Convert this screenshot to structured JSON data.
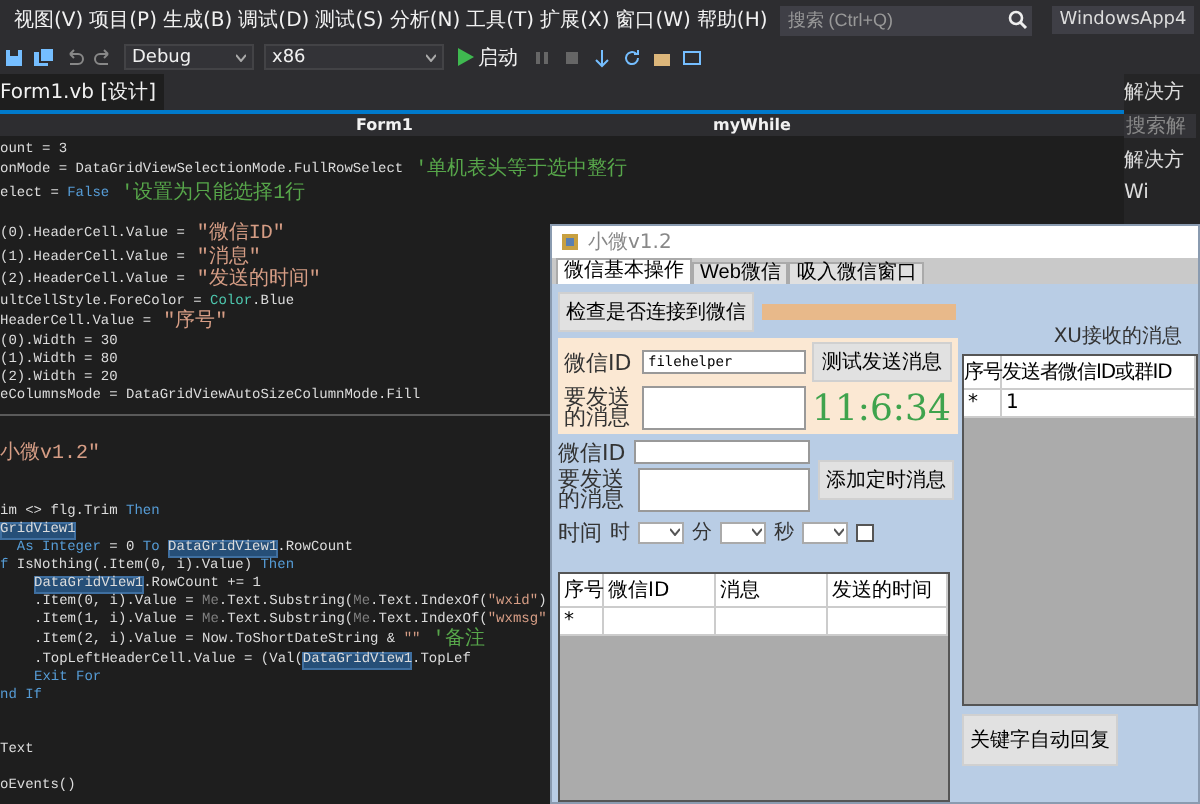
{
  "menu": [
    "视图(V)",
    "项目(P)",
    "生成(B)",
    "调试(D)",
    "测试(S)",
    "分析(N)",
    "工具(T)",
    "扩展(X)",
    "窗口(W)",
    "帮助(H)"
  ],
  "search": {
    "placeholder": "搜索 (Ctrl+Q)"
  },
  "solution_name": "WindowsApp4",
  "toolbar": {
    "configuration": "Debug",
    "platform": "x86",
    "start": "启动"
  },
  "document_tab": "Form1.vb [设计]",
  "nav": [
    "Form1",
    "myWhile"
  ],
  "code_blocks": [
    [
      {
        "kind": "code",
        "indent": false,
        "segments": [
          {
            "kind": "plain",
            "text": "ount = 3"
          }
        ]
      },
      {
        "kind": "code",
        "indent": false,
        "segments": [
          {
            "kind": "plain",
            "text": "onMode = DataGridViewSelectionMode.FullRowSelect"
          },
          {
            "kind": "comment",
            "text": " '单机表头等于选中整行"
          }
        ]
      },
      {
        "kind": "code",
        "indent": false,
        "segments": [
          {
            "kind": "plain",
            "text": "elect ="
          },
          {
            "kind": "keyword",
            "text": " False"
          },
          {
            "kind": "comment",
            "text": " '设置为只能选择1行"
          }
        ]
      },
      {
        "kind": "blank"
      },
      {
        "kind": "code",
        "indent": false,
        "segments": [
          {
            "kind": "plain",
            "text": "(0).HeaderCell.Value ="
          },
          {
            "kind": "string",
            "text": " \"微信ID\""
          }
        ]
      },
      {
        "kind": "code",
        "indent": false,
        "segments": [
          {
            "kind": "plain",
            "text": "(1).HeaderCell.Value ="
          },
          {
            "kind": "string",
            "text": " \"消息\""
          }
        ]
      },
      {
        "kind": "code",
        "indent": false,
        "segments": [
          {
            "kind": "plain",
            "text": "(2).HeaderCell.Value ="
          },
          {
            "kind": "string",
            "text": " \"发送的时间\""
          }
        ]
      },
      {
        "kind": "code",
        "indent": false,
        "segments": [
          {
            "kind": "plain",
            "text": "ultCellStyle.ForeColor ="
          },
          {
            "kind": "type",
            "text": " Color"
          },
          {
            "kind": "plain",
            "text": ".Blue"
          }
        ]
      },
      {
        "kind": "code",
        "indent": false,
        "segments": [
          {
            "kind": "plain",
            "text": "HeaderCell.Value ="
          },
          {
            "kind": "string",
            "text": " \"序号\""
          }
        ]
      },
      {
        "kind": "code",
        "indent": false,
        "segments": [
          {
            "kind": "plain",
            "text": "(0).Width = 30"
          }
        ]
      },
      {
        "kind": "code",
        "indent": false,
        "segments": [
          {
            "kind": "plain",
            "text": "(1).Width = 80"
          }
        ]
      },
      {
        "kind": "code",
        "indent": false,
        "segments": [
          {
            "kind": "plain",
            "text": "(2).Width = 20"
          }
        ]
      },
      {
        "kind": "code",
        "indent": false,
        "segments": [
          {
            "kind": "plain",
            "text": "eColumnsMode = DataGridViewAutoSizeColumnMode.Fill"
          }
        ]
      }
    ],
    [
      {
        "kind": "blank"
      },
      {
        "kind": "code",
        "indent": false,
        "segments": [
          {
            "kind": "string",
            "text": "小微v1.2\""
          }
        ]
      },
      {
        "kind": "blank"
      },
      {
        "kind": "blank"
      },
      {
        "kind": "code",
        "indent": false,
        "segments": [
          {
            "kind": "plain",
            "text": "im <> flg.Trim"
          },
          {
            "kind": "keyword",
            "text": " Then"
          }
        ]
      },
      {
        "kind": "code",
        "indent": false,
        "segments": [
          {
            "kind": "ref",
            "text": "GridView1"
          }
        ]
      },
      {
        "kind": "code",
        "indent": false,
        "segments": [
          {
            "kind": "keyword",
            "text": "  As Integer"
          },
          {
            "kind": "plain",
            "text": " = 0"
          },
          {
            "kind": "keyword",
            "text": " To "
          },
          {
            "kind": "ref",
            "text": "DataGridView1"
          },
          {
            "kind": "plain",
            "text": ".RowCount"
          }
        ]
      },
      {
        "kind": "code",
        "indent": false,
        "segments": [
          {
            "kind": "keyword",
            "text": "f"
          },
          {
            "kind": "plain",
            "text": " IsNothing(.Item(0, i).Value)"
          },
          {
            "kind": "keyword",
            "text": " Then"
          }
        ]
      },
      {
        "kind": "code",
        "indent": true,
        "segments": [
          {
            "kind": "ref",
            "text": "DataGridView1"
          },
          {
            "kind": "plain",
            "text": ".RowCount += 1"
          }
        ]
      },
      {
        "kind": "code",
        "indent": true,
        "segments": [
          {
            "kind": "plain",
            "text": ".Item(0, i).Value = "
          },
          {
            "kind": "me",
            "text": "Me"
          },
          {
            "kind": "plain",
            "text": ".Text.Substring("
          },
          {
            "kind": "me",
            "text": "Me"
          },
          {
            "kind": "plain",
            "text": ".Text.IndexOf("
          },
          {
            "kind": "string",
            "text": "\"wxid\""
          },
          {
            "kind": "plain",
            "text": ")"
          }
        ]
      },
      {
        "kind": "code",
        "indent": true,
        "segments": [
          {
            "kind": "plain",
            "text": ".Item(1, i).Value = "
          },
          {
            "kind": "me",
            "text": "Me"
          },
          {
            "kind": "plain",
            "text": ".Text.Substring("
          },
          {
            "kind": "me",
            "text": "Me"
          },
          {
            "kind": "plain",
            "text": ".Text.IndexOf("
          },
          {
            "kind": "string",
            "text": "\"wxmsg\""
          }
        ]
      },
      {
        "kind": "code",
        "indent": true,
        "segments": [
          {
            "kind": "plain",
            "text": ".Item(2, i).Value = Now.ToShortDateString &"
          },
          {
            "kind": "string",
            "text": " \"\""
          },
          {
            "kind": "comment",
            "text": " '备注"
          }
        ]
      },
      {
        "kind": "code",
        "indent": true,
        "segments": [
          {
            "kind": "plain",
            "text": ".TopLeftHeaderCell.Value = (Val("
          },
          {
            "kind": "ref",
            "text": "DataGridView1"
          },
          {
            "kind": "plain",
            "text": ".TopLef"
          }
        ]
      },
      {
        "kind": "code",
        "indent": true,
        "segments": [
          {
            "kind": "keyword",
            "text": "Exit For"
          }
        ]
      },
      {
        "kind": "code",
        "indent": false,
        "segments": [
          {
            "kind": "keyword",
            "text": "nd If"
          }
        ]
      },
      {
        "kind": "blank"
      },
      {
        "kind": "blank"
      },
      {
        "kind": "code",
        "indent": false,
        "segments": [
          {
            "kind": "plain",
            "text": "Text"
          }
        ]
      },
      {
        "kind": "blank"
      },
      {
        "kind": "code",
        "indent": false,
        "segments": [
          {
            "kind": "plain",
            "text": "oEvents()"
          }
        ]
      }
    ]
  ],
  "solution_panel": {
    "title": "解决方",
    "search_placeholder": "搜索解",
    "items": [
      "解决方",
      "Wi"
    ]
  },
  "form": {
    "title": "小微v1.2",
    "tabs": [
      {
        "label": "微信基本操作",
        "selected": true
      },
      {
        "label": "Web微信",
        "selected": false
      },
      {
        "label": "吸入微信窗口",
        "selected": false
      }
    ],
    "check_button": "检查是否连接到微信",
    "progress": {
      "level": 1
    },
    "test": {
      "id_label": "微信ID",
      "id_value": "filehelper",
      "message_label": "要发送的消息",
      "send_button": "测试发送消息",
      "clock": "11:6:34"
    },
    "schedule": {
      "id_label": "微信ID",
      "message_label": "要发送的消息",
      "add_button": "添加定时消息",
      "time_label": "时间",
      "units": [
        "时",
        "分",
        "秒"
      ],
      "enabled": false
    },
    "schedule_grid": {
      "columns": [
        "序号",
        "微信ID",
        "消息",
        "发送的时间"
      ],
      "rows": [
        [
          "*"
        ]
      ]
    },
    "received_label": "XU接收的消息",
    "received_grid": {
      "columns": [
        "序号",
        "发送者微信ID或群ID"
      ],
      "rows": [
        [
          "*",
          "1"
        ]
      ]
    },
    "reply_button": "关键字自动回复"
  }
}
